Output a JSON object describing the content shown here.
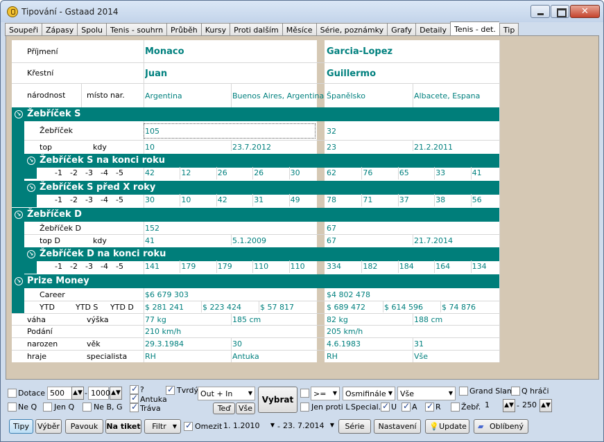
{
  "window": {
    "title": "Tipování - Gstaad 2014"
  },
  "tabs": [
    "Soupeři",
    "Zápasy",
    "Spolu",
    "Tenis - souhrn",
    "Průběh",
    "Kursy",
    "Proti dalším",
    "Měsíce",
    "Série, poznámky",
    "Grafy",
    "Detaily",
    "Tenis - det.",
    "Tip"
  ],
  "active_tab": "Tenis - det.",
  "labels": {
    "prijmeni": "Příjmení",
    "krestni": "Křestní",
    "narodnost": "národnost",
    "misto_nar": "místo nar.",
    "zebricek_s": "Žebříček S",
    "zebricek": "Žebříček",
    "top": "top",
    "kdy": "kdy",
    "zebricek_s_konec": "Žebříček S na konci roku",
    "zebricek_s_pred": "Žebříček S před X roky",
    "zebricek_d": "Žebříček D",
    "zebricek_d_row": "Žebříček D",
    "top_d": "top D",
    "zebricek_d_konec": "Žebříček D na konci roku",
    "prize_money": "Prize Money",
    "career": "Career",
    "ytd": "YTD",
    "ytd_s": "YTD S",
    "ytd_d": "YTD D",
    "vaha": "váha",
    "vyska": "výška",
    "podani": "Podání",
    "narozen": "narozen",
    "vek": "věk",
    "hraje": "hraje",
    "specialista": "specialista"
  },
  "year_offsets": [
    "-1",
    "-2",
    "-3",
    "-4",
    "-5"
  ],
  "p1": {
    "surname": "Monaco",
    "first": "Juan",
    "nationality": "Argentina",
    "birthplace": "Buenos Aires, Argentina",
    "rank_s": "105",
    "top_s": "10",
    "top_s_date": "23.7.2012",
    "s_end": [
      "42",
      "12",
      "26",
      "26",
      "30"
    ],
    "s_before": [
      "30",
      "10",
      "42",
      "31",
      "49"
    ],
    "rank_d": "152",
    "top_d": "41",
    "top_d_date": "5.1.2009",
    "d_end": [
      "141",
      "179",
      "179",
      "110",
      "110"
    ],
    "career": "$6 679 303",
    "ytd": "$ 281 241",
    "ytd_s": "$ 223 424",
    "ytd_d": "$ 57 817",
    "weight": "77 kg",
    "height": "185 cm",
    "serve": "210 km/h",
    "born": "29.3.1984",
    "age": "30",
    "plays": "RH",
    "specialist": "Antuka"
  },
  "p2": {
    "surname": "Garcia-Lopez",
    "first": "Guillermo",
    "nationality": "Španělsko",
    "birthplace": "Albacete, Espana",
    "rank_s": "32",
    "top_s": "23",
    "top_s_date": "21.2.2011",
    "s_end": [
      "62",
      "76",
      "65",
      "33",
      "41"
    ],
    "s_before": [
      "78",
      "71",
      "37",
      "38",
      "56"
    ],
    "rank_d": "67",
    "top_d": "67",
    "top_d_date": "21.7.2014",
    "d_end": [
      "334",
      "182",
      "184",
      "164",
      "134"
    ],
    "career": "$4 802 478",
    "ytd": "$ 689 472",
    "ytd_s": "$ 614 596",
    "ytd_d": "$ 74 876",
    "weight": "82 kg",
    "height": "188 cm",
    "serve": "205 km/h",
    "born": "4.6.1983",
    "age": "31",
    "plays": "RH",
    "specialist": "Vše"
  },
  "filters": {
    "dotace": "Dotace",
    "dotace_from": "500",
    "dotace_to": "1000",
    "q": "?",
    "antuka": "Antuka",
    "trava": "Tráva",
    "tvrdy": "Tvrdý",
    "surface_select": "Out + In",
    "ted": "Teď",
    "vse": "Vše",
    "vybrat": "Vybrat",
    "cmp_select": ">=",
    "round_select": "Osmifinále",
    "all_select": "Vše",
    "grand_slam": "Grand Slam",
    "q_hraci": "Q hráči",
    "ne_q": "Ne Q",
    "jen_q": "Jen Q",
    "ne_bg": "Ne B, G",
    "jen_proti_l": "Jen proti L",
    "special": "Special.",
    "u": "U",
    "a": "A",
    "r": "R",
    "zebr": "Žebř.",
    "zebr_from": "1",
    "zebr_to": "250"
  },
  "bottom": {
    "tipy": "Tipy",
    "vyber": "Výběr",
    "pavouk": "Pavouk",
    "na_tiket": "Na tiket",
    "filtr": "Filtr",
    "omezit": "Omezit",
    "date_from": "1. 1.2010",
    "date_to": "23. 7.2014",
    "serie": "Série",
    "nastaveni": "Nastavení",
    "update": "Update",
    "oblibeny": "Oblíbený"
  }
}
